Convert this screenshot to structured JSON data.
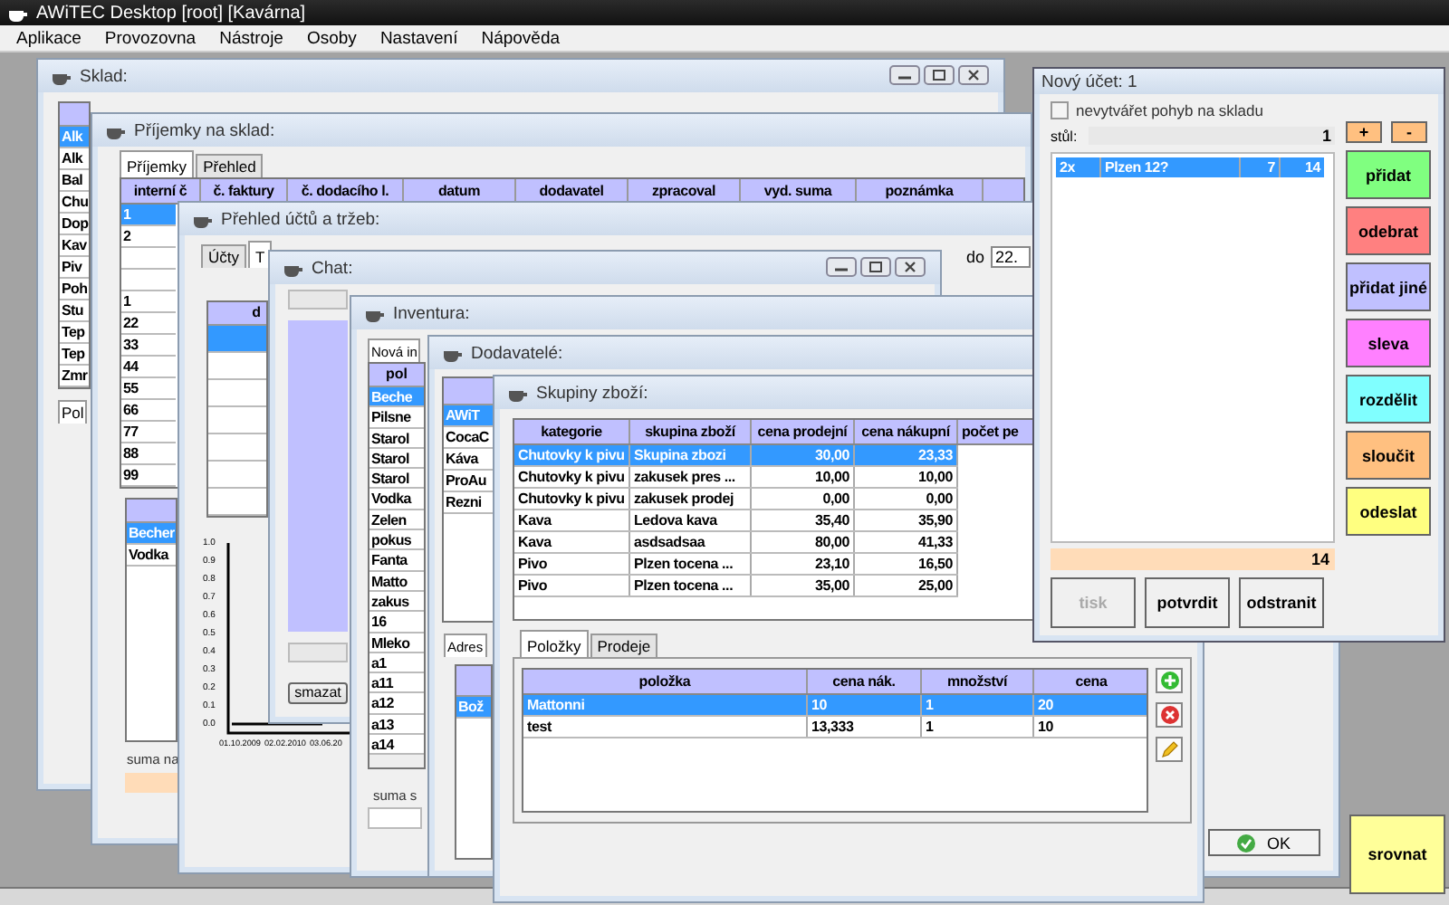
{
  "app_title": "AWiTEC Desktop [root] [Kavárna]",
  "menu": [
    "Aplikace",
    "Provozovna",
    "Nástroje",
    "Osoby",
    "Nastavení",
    "Nápověda"
  ],
  "sklad": {
    "title": "Sklad:",
    "items": [
      {
        "label": "Alk",
        "selected": true
      },
      {
        "label": "Alk",
        "selected": false
      },
      {
        "label": "Bal",
        "selected": false
      },
      {
        "label": "Chu",
        "selected": false
      },
      {
        "label": "Dop",
        "selected": false
      },
      {
        "label": "Kav",
        "selected": false
      },
      {
        "label": "Piv",
        "selected": false
      },
      {
        "label": "Poh",
        "selected": false
      },
      {
        "label": "Stu",
        "selected": false
      },
      {
        "label": "Tep",
        "selected": false
      },
      {
        "label": "Tep",
        "selected": false
      },
      {
        "label": "Zmr",
        "selected": false
      }
    ],
    "tab": "Pol"
  },
  "prijemky": {
    "title": "Příjemky na sklad:",
    "tabs": [
      {
        "label": "Příjemky",
        "selected": true
      },
      {
        "label": "Přehled",
        "selected": false
      }
    ],
    "columns": [
      "interní č",
      "č. faktury",
      "č. dodacího l.",
      "datum",
      "dodavatel",
      "zpracoval",
      "vyd. suma",
      "poznámka"
    ],
    "rows": [
      {
        "value": "1",
        "selected": true
      },
      {
        "value": "2",
        "selected": false
      },
      {
        "selected": false
      },
      {
        "selected": false
      },
      {
        "value": "1",
        "selected": false
      },
      {
        "value": "22",
        "selected": false
      },
      {
        "value": "33",
        "selected": false
      },
      {
        "value": "44",
        "selected": false
      },
      {
        "value": "55",
        "selected": false
      },
      {
        "value": "66",
        "selected": false
      },
      {
        "value": "77",
        "selected": false
      },
      {
        "value": "88",
        "selected": false
      },
      {
        "value": "99",
        "selected": false
      }
    ],
    "items": [
      {
        "label": "Becher",
        "selected": true
      },
      {
        "label": "Vodka",
        "selected": false
      }
    ],
    "sum_label": "suma na"
  },
  "prehled": {
    "title": "Přehled účtů a tržeb:",
    "tabs": [
      {
        "label": "Účty",
        "selected": false
      },
      {
        "label": "T",
        "selected": true
      }
    ],
    "column": "d",
    "rows": [
      {
        "selected": true
      },
      {
        "selected": false
      },
      {
        "selected": false
      },
      {
        "selected": false
      },
      {
        "selected": false
      },
      {
        "selected": false
      },
      {
        "selected": false
      }
    ],
    "date_to_label": "do",
    "date_to": "22.",
    "chart_data": {
      "type": "line",
      "categories": [
        "01.10.2009",
        "02.02.2010",
        "03.06.20"
      ],
      "yticks": [
        {
          "value": 0,
          "label": "0.0"
        },
        0.1,
        0.2,
        0.3,
        0.4,
        0.5,
        0.6,
        0.7,
        0.8,
        0.9,
        {
          "value": 1,
          "label": "1.0"
        }
      ],
      "ylim": [
        -0.05,
        1
      ],
      "series": [
        {
          "color": "#000000",
          "values": [
            0,
            0,
            0
          ]
        }
      ]
    }
  },
  "chat": {
    "title": "Chat:",
    "button": "smazat"
  },
  "inventura": {
    "title": "Inventura:",
    "tab": "Nová in",
    "column": "pol",
    "rows": [
      {
        "label": "Beche",
        "selected": true
      },
      {
        "label": "Pilsne",
        "selected": false
      },
      {
        "label": "Starol",
        "selected": false
      },
      {
        "label": "Starol",
        "selected": false
      },
      {
        "label": "Starol",
        "selected": false
      },
      {
        "label": "Vodka",
        "selected": false
      },
      {
        "label": "Zelen",
        "selected": false
      },
      {
        "label": "pokus",
        "selected": false
      },
      {
        "label": "Fanta",
        "selected": false
      },
      {
        "label": "Matto",
        "selected": false
      },
      {
        "label": "zakus",
        "selected": false
      },
      {
        "label": "16",
        "selected": false
      },
      {
        "label": "Mleko",
        "selected": false
      },
      {
        "label": "a1",
        "selected": false
      },
      {
        "label": "a11",
        "selected": false
      },
      {
        "label": "a12",
        "selected": false
      },
      {
        "label": "a13",
        "selected": false
      },
      {
        "label": "a14",
        "selected": false
      }
    ],
    "sum_label": "suma s"
  },
  "dodavatele": {
    "title": "Dodavatelé:",
    "rows": [
      {
        "label": "AWiT",
        "selected": true
      },
      {
        "label": "CocaC",
        "selected": false
      },
      {
        "label": "Káva",
        "selected": false
      },
      {
        "label": "ProAu",
        "selected": false
      },
      {
        "label": "Rezni",
        "selected": false
      }
    ],
    "tab": "Adres",
    "address_rows": [
      {
        "label": "Bož",
        "selected": true
      }
    ],
    "ok_button": "OK"
  },
  "skupiny": {
    "title": "Skupiny zboží:",
    "columns": [
      "kategorie",
      "skupina zboží",
      "cena prodejní",
      "cena nákupní",
      "počet pe"
    ],
    "rows": [
      {
        "cells": [
          "Chutovky k pivu",
          "Skupina zbozi",
          "30,00",
          "23,33"
        ],
        "selected": true
      },
      {
        "cells": [
          "Chutovky k pivu",
          "zakusek pres ...",
          "10,00",
          "10,00"
        ],
        "selected": false
      },
      {
        "cells": [
          "Chutovky k pivu",
          "zakusek prodej",
          "0,00",
          "0,00"
        ],
        "selected": false
      },
      {
        "cells": [
          "Kava",
          "Ledova kava",
          "35,40",
          "35,90"
        ],
        "selected": false
      },
      {
        "cells": [
          "Kava",
          "asdsadsaa",
          "80,00",
          "41,33"
        ],
        "selected": false
      },
      {
        "cells": [
          "Pivo",
          "Plzen tocena ...",
          "23,10",
          "16,50"
        ],
        "selected": false
      },
      {
        "cells": [
          "Pivo",
          "Plzen tocena ...",
          "35,00",
          "25,00"
        ],
        "selected": false
      }
    ],
    "tabs": [
      {
        "label": "Položky",
        "selected": true
      },
      {
        "label": "Prodeje",
        "selected": false
      }
    ],
    "item_columns": [
      "položka",
      "cena nák.",
      "množství",
      "cena"
    ],
    "item_rows": [
      {
        "cells": [
          "Mattonni",
          "10",
          "1",
          "20"
        ],
        "selected": true
      },
      {
        "cells": [
          "test",
          "13,333",
          "1",
          "10"
        ],
        "selected": false
      }
    ]
  },
  "novy_ucet": {
    "title": "Nový účet: 1",
    "no_stock_move": {
      "label": "nevytvářet pohyb na skladu",
      "checked": false
    },
    "table_label": "stůl:",
    "table_value": "1",
    "plus": "+",
    "minus": "-",
    "lines": [
      {
        "cells": [
          "2x",
          "Plzen 12?",
          "7",
          "14"
        ],
        "selected": true
      }
    ],
    "actions": [
      {
        "label": "přidat",
        "color": "#80ff80"
      },
      {
        "label": "odebrat",
        "color": "#ff8080"
      },
      {
        "label": "přidat jiné",
        "color": "#c0c0ff"
      },
      {
        "label": "sleva",
        "color": "#ff80ff"
      },
      {
        "label": "rozdělit",
        "color": "#80ffff"
      },
      {
        "label": "sloučit",
        "color": "#ffc080"
      },
      {
        "label": "odeslat",
        "color": "#ffff80"
      }
    ],
    "total": "14",
    "buttons": [
      {
        "label": "tisk",
        "disabled": true
      },
      {
        "label": "potvrdit",
        "disabled": false
      },
      {
        "label": "odstranit",
        "disabled": false
      }
    ]
  },
  "srovnat_button": "srovnat"
}
